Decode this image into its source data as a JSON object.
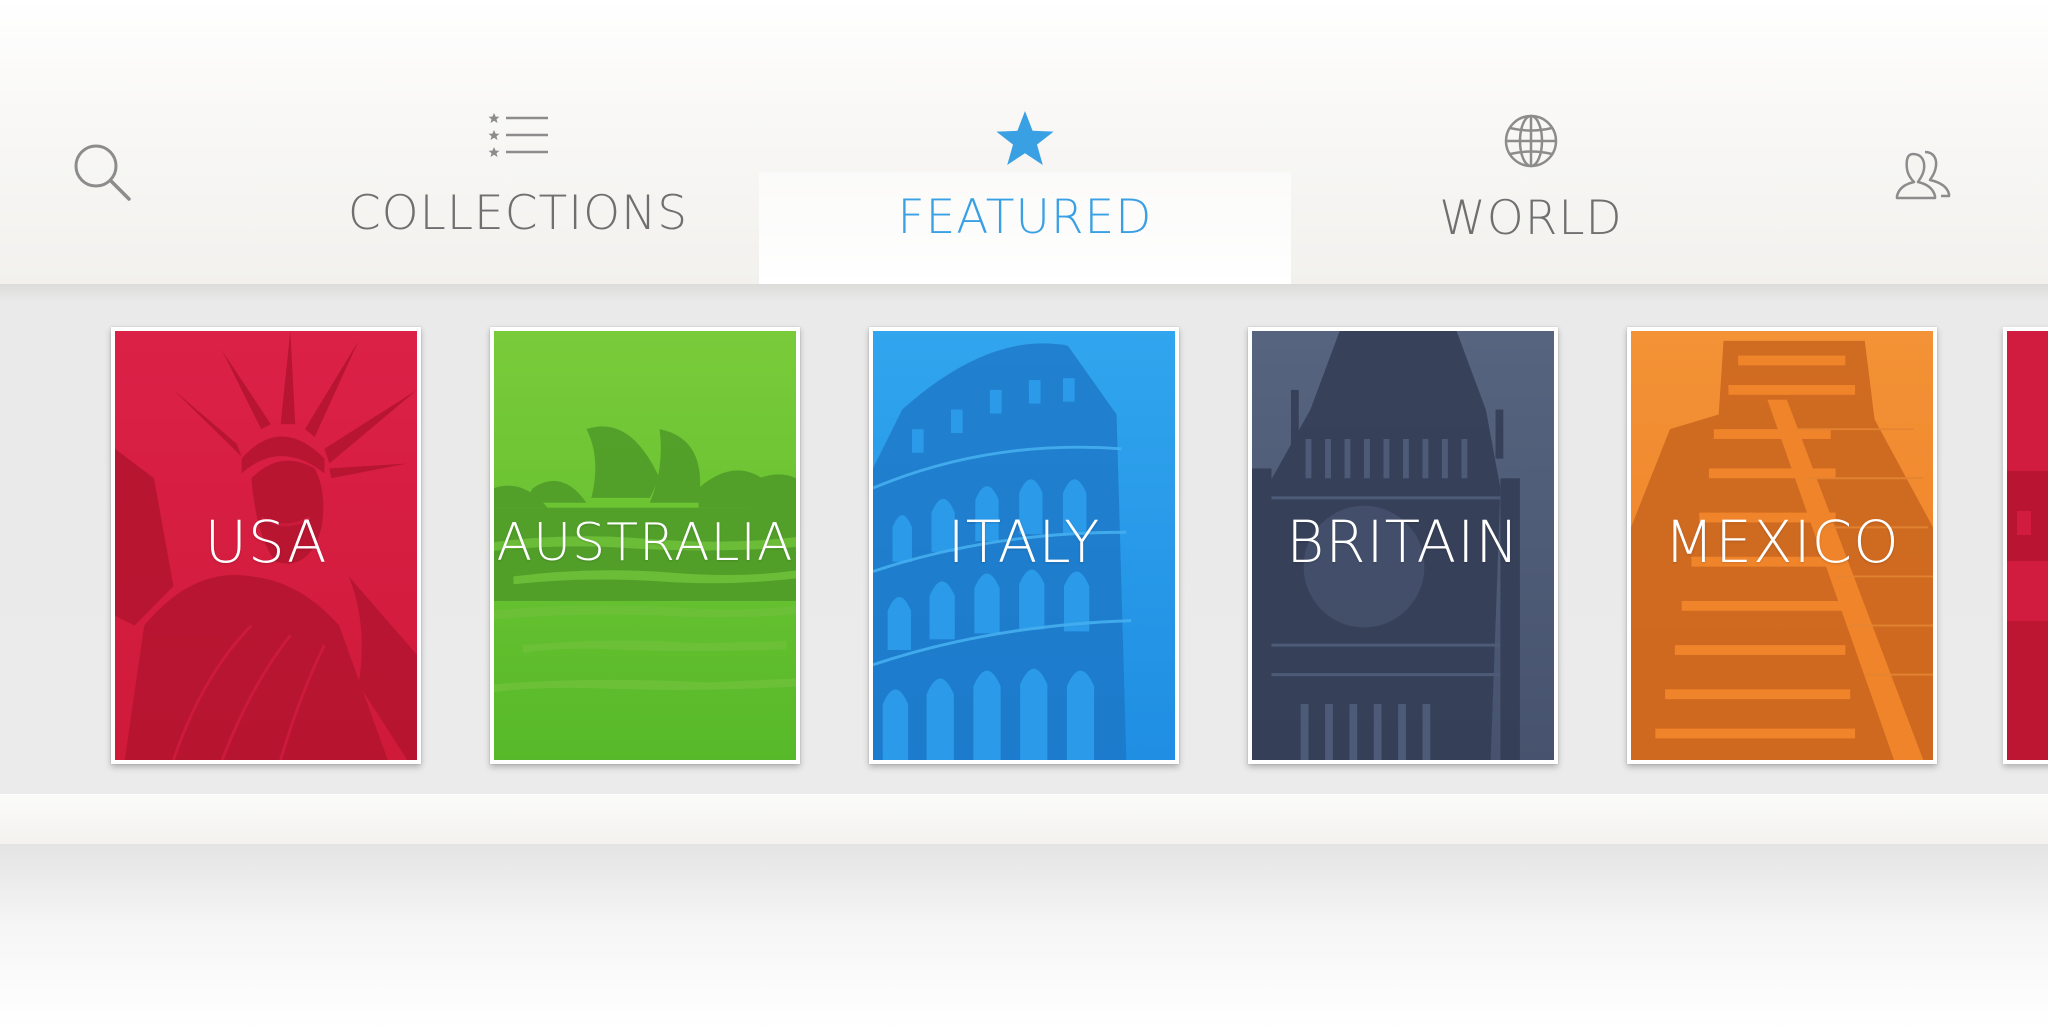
{
  "nav": {
    "search_icon": "search-icon",
    "people_icon": "people-icon",
    "tabs": [
      {
        "label": "COLLECTIONS",
        "icon": "list-icon"
      },
      {
        "label": "FEATURED",
        "icon": "star-icon",
        "active": true
      },
      {
        "label": "WORLD",
        "icon": "globe-icon"
      }
    ]
  },
  "books": [
    {
      "title": "USA",
      "color": "#d21c3f",
      "art": "statue-of-liberty"
    },
    {
      "title": "AUSTRALIA",
      "color": "#5fbd2e",
      "art": "sydney-opera-house"
    },
    {
      "title": "ITALY",
      "color": "#2a9ae9",
      "art": "colosseum"
    },
    {
      "title": "BRITAIN",
      "color": "#4e5b78",
      "art": "big-ben"
    },
    {
      "title": "MEXICO",
      "color": "#f0842a",
      "art": "chichen-itza"
    }
  ],
  "colors": {
    "accent": "#3aa0e4",
    "nav_text": "#6f6f6f",
    "icon_gray": "#8c8c8c"
  }
}
